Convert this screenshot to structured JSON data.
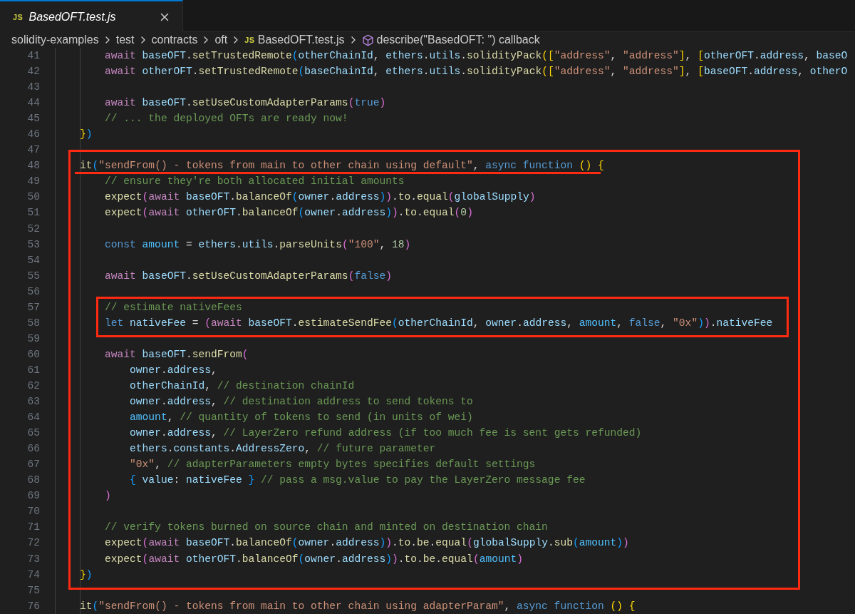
{
  "tab": {
    "icon_text": "JS",
    "title": "BasedOFT.test.js",
    "selected": true
  },
  "breadcrumb": {
    "folders": [
      "solidity-examples",
      "test",
      "contracts",
      "oft"
    ],
    "file_icon_text": "JS",
    "file": "BasedOFT.test.js",
    "symbol": "describe(\"BasedOFT: \") callback"
  },
  "lines": [
    {
      "n": "41",
      "tokens": [
        {
          "kind": "k",
          "text": "        await "
        },
        {
          "kind": "v",
          "text": "baseOFT"
        },
        {
          "kind": "p",
          "text": "."
        },
        {
          "kind": "f",
          "text": "setTrustedRemote"
        },
        {
          "kind": "b3",
          "text": "("
        },
        {
          "kind": "v",
          "text": "otherChainId"
        },
        {
          "kind": "p",
          "text": ", "
        },
        {
          "kind": "v",
          "text": "ethers"
        },
        {
          "kind": "p",
          "text": "."
        },
        {
          "kind": "v",
          "text": "utils"
        },
        {
          "kind": "p",
          "text": "."
        },
        {
          "kind": "f",
          "text": "solidityPack"
        },
        {
          "kind": "b1",
          "text": "(["
        },
        {
          "kind": "t",
          "text": "\"address\""
        },
        {
          "kind": "p",
          "text": ", "
        },
        {
          "kind": "t",
          "text": "\"address\""
        },
        {
          "kind": "b1",
          "text": "]"
        },
        {
          "kind": "p",
          "text": ", "
        },
        {
          "kind": "b1",
          "text": "["
        },
        {
          "kind": "v",
          "text": "otherOFT"
        },
        {
          "kind": "p",
          "text": "."
        },
        {
          "kind": "v",
          "text": "address"
        },
        {
          "kind": "p",
          "text": ", "
        },
        {
          "kind": "v",
          "text": "baseO"
        }
      ]
    },
    {
      "n": "42",
      "tokens": [
        {
          "kind": "k",
          "text": "        await "
        },
        {
          "kind": "v",
          "text": "otherOFT"
        },
        {
          "kind": "p",
          "text": "."
        },
        {
          "kind": "f",
          "text": "setTrustedRemote"
        },
        {
          "kind": "b3",
          "text": "("
        },
        {
          "kind": "v",
          "text": "baseChainId"
        },
        {
          "kind": "p",
          "text": ", "
        },
        {
          "kind": "v",
          "text": "ethers"
        },
        {
          "kind": "p",
          "text": "."
        },
        {
          "kind": "v",
          "text": "utils"
        },
        {
          "kind": "p",
          "text": "."
        },
        {
          "kind": "f",
          "text": "solidityPack"
        },
        {
          "kind": "b1",
          "text": "(["
        },
        {
          "kind": "t",
          "text": "\"address\""
        },
        {
          "kind": "p",
          "text": ", "
        },
        {
          "kind": "t",
          "text": "\"address\""
        },
        {
          "kind": "b1",
          "text": "]"
        },
        {
          "kind": "p",
          "text": ", "
        },
        {
          "kind": "b1",
          "text": "["
        },
        {
          "kind": "v",
          "text": "baseOFT"
        },
        {
          "kind": "p",
          "text": "."
        },
        {
          "kind": "v",
          "text": "address"
        },
        {
          "kind": "p",
          "text": ", "
        },
        {
          "kind": "v",
          "text": "otherO"
        }
      ]
    },
    {
      "n": "43"
    },
    {
      "n": "44",
      "tokens": [
        {
          "kind": "k",
          "text": "        await "
        },
        {
          "kind": "v",
          "text": "baseOFT"
        },
        {
          "kind": "p",
          "text": "."
        },
        {
          "kind": "f",
          "text": "setUseCustomAdapterParams"
        },
        {
          "kind": "b2",
          "text": "("
        },
        {
          "kind": "s",
          "text": "true"
        },
        {
          "kind": "b2",
          "text": ")"
        }
      ]
    },
    {
      "n": "45",
      "tokens": [
        {
          "kind": "m",
          "text": "        // ... the deployed OFTs are ready now!"
        }
      ]
    },
    {
      "n": "46",
      "tokens": [
        {
          "kind": "b1",
          "text": "    }"
        },
        {
          "kind": "b3",
          "text": ")"
        }
      ]
    },
    {
      "n": "47"
    },
    {
      "n": "48",
      "tokens": [
        {
          "kind": "f",
          "text": "    it"
        },
        {
          "kind": "b3",
          "text": "("
        },
        {
          "kind": "t",
          "text": "\"sendFrom() - tokens from main to other chain using default\""
        },
        {
          "kind": "p",
          "text": ", "
        },
        {
          "kind": "s",
          "text": "async function "
        },
        {
          "kind": "b1",
          "text": "() {"
        }
      ]
    },
    {
      "n": "49",
      "tokens": [
        {
          "kind": "m",
          "text": "        // ensure they're both allocated initial amounts"
        }
      ]
    },
    {
      "n": "50",
      "tokens": [
        {
          "kind": "f",
          "text": "        expect"
        },
        {
          "kind": "b2",
          "text": "("
        },
        {
          "kind": "k",
          "text": "await "
        },
        {
          "kind": "v",
          "text": "baseOFT"
        },
        {
          "kind": "p",
          "text": "."
        },
        {
          "kind": "f",
          "text": "balanceOf"
        },
        {
          "kind": "b3",
          "text": "("
        },
        {
          "kind": "v",
          "text": "owner"
        },
        {
          "kind": "p",
          "text": "."
        },
        {
          "kind": "v",
          "text": "address"
        },
        {
          "kind": "b3",
          "text": ")"
        },
        {
          "kind": "b2",
          "text": ")"
        },
        {
          "kind": "p",
          "text": "."
        },
        {
          "kind": "f",
          "text": "to"
        },
        {
          "kind": "p",
          "text": "."
        },
        {
          "kind": "f",
          "text": "equal"
        },
        {
          "kind": "b2",
          "text": "("
        },
        {
          "kind": "v",
          "text": "globalSupply"
        },
        {
          "kind": "b2",
          "text": ")"
        }
      ]
    },
    {
      "n": "51",
      "tokens": [
        {
          "kind": "f",
          "text": "        expect"
        },
        {
          "kind": "b2",
          "text": "("
        },
        {
          "kind": "k",
          "text": "await "
        },
        {
          "kind": "v",
          "text": "otherOFT"
        },
        {
          "kind": "p",
          "text": "."
        },
        {
          "kind": "f",
          "text": "balanceOf"
        },
        {
          "kind": "b3",
          "text": "("
        },
        {
          "kind": "v",
          "text": "owner"
        },
        {
          "kind": "p",
          "text": "."
        },
        {
          "kind": "v",
          "text": "address"
        },
        {
          "kind": "b3",
          "text": ")"
        },
        {
          "kind": "b2",
          "text": ")"
        },
        {
          "kind": "p",
          "text": "."
        },
        {
          "kind": "f",
          "text": "to"
        },
        {
          "kind": "p",
          "text": "."
        },
        {
          "kind": "f",
          "text": "equal"
        },
        {
          "kind": "b2",
          "text": "("
        },
        {
          "kind": "n",
          "text": "0"
        },
        {
          "kind": "b2",
          "text": ")"
        }
      ]
    },
    {
      "n": "52"
    },
    {
      "n": "53",
      "tokens": [
        {
          "kind": "s",
          "text": "        const "
        },
        {
          "kind": "c",
          "text": "amount"
        },
        {
          "kind": "p",
          "text": " = "
        },
        {
          "kind": "v",
          "text": "ethers"
        },
        {
          "kind": "p",
          "text": "."
        },
        {
          "kind": "v",
          "text": "utils"
        },
        {
          "kind": "p",
          "text": "."
        },
        {
          "kind": "f",
          "text": "parseUnits"
        },
        {
          "kind": "b2",
          "text": "("
        },
        {
          "kind": "t",
          "text": "\"100\""
        },
        {
          "kind": "p",
          "text": ", "
        },
        {
          "kind": "n",
          "text": "18"
        },
        {
          "kind": "b2",
          "text": ")"
        }
      ]
    },
    {
      "n": "54"
    },
    {
      "n": "55",
      "tokens": [
        {
          "kind": "k",
          "text": "        await "
        },
        {
          "kind": "v",
          "text": "baseOFT"
        },
        {
          "kind": "p",
          "text": "."
        },
        {
          "kind": "f",
          "text": "setUseCustomAdapterParams"
        },
        {
          "kind": "b2",
          "text": "("
        },
        {
          "kind": "s",
          "text": "false"
        },
        {
          "kind": "b2",
          "text": ")"
        }
      ]
    },
    {
      "n": "56"
    },
    {
      "n": "57",
      "tokens": [
        {
          "kind": "m",
          "text": "        // estimate nativeFees"
        }
      ]
    },
    {
      "n": "58",
      "tokens": [
        {
          "kind": "s",
          "text": "        let "
        },
        {
          "kind": "v",
          "text": "nativeFee"
        },
        {
          "kind": "p",
          "text": " = "
        },
        {
          "kind": "b2",
          "text": "("
        },
        {
          "kind": "k",
          "text": "await "
        },
        {
          "kind": "v",
          "text": "baseOFT"
        },
        {
          "kind": "p",
          "text": "."
        },
        {
          "kind": "f",
          "text": "estimateSendFee"
        },
        {
          "kind": "b3",
          "text": "("
        },
        {
          "kind": "v",
          "text": "otherChainId"
        },
        {
          "kind": "p",
          "text": ", "
        },
        {
          "kind": "v",
          "text": "owner"
        },
        {
          "kind": "p",
          "text": "."
        },
        {
          "kind": "v",
          "text": "address"
        },
        {
          "kind": "p",
          "text": ", "
        },
        {
          "kind": "c",
          "text": "amount"
        },
        {
          "kind": "p",
          "text": ", "
        },
        {
          "kind": "s",
          "text": "false"
        },
        {
          "kind": "p",
          "text": ", "
        },
        {
          "kind": "t",
          "text": "\"0x\""
        },
        {
          "kind": "b3",
          "text": ")"
        },
        {
          "kind": "b2",
          "text": ")"
        },
        {
          "kind": "p",
          "text": "."
        },
        {
          "kind": "v",
          "text": "nativeFee"
        }
      ]
    },
    {
      "n": "59"
    },
    {
      "n": "60",
      "tokens": [
        {
          "kind": "k",
          "text": "        await "
        },
        {
          "kind": "v",
          "text": "baseOFT"
        },
        {
          "kind": "p",
          "text": "."
        },
        {
          "kind": "f",
          "text": "sendFrom"
        },
        {
          "kind": "b2",
          "text": "("
        }
      ]
    },
    {
      "n": "61",
      "tokens": [
        {
          "kind": "v",
          "text": "            owner"
        },
        {
          "kind": "p",
          "text": "."
        },
        {
          "kind": "v",
          "text": "address"
        },
        {
          "kind": "p",
          "text": ","
        }
      ]
    },
    {
      "n": "62",
      "tokens": [
        {
          "kind": "v",
          "text": "            otherChainId"
        },
        {
          "kind": "p",
          "text": ", "
        },
        {
          "kind": "m",
          "text": "// destination chainId"
        }
      ]
    },
    {
      "n": "63",
      "tokens": [
        {
          "kind": "v",
          "text": "            owner"
        },
        {
          "kind": "p",
          "text": "."
        },
        {
          "kind": "v",
          "text": "address"
        },
        {
          "kind": "p",
          "text": ", "
        },
        {
          "kind": "m",
          "text": "// destination address to send tokens to"
        }
      ]
    },
    {
      "n": "64",
      "tokens": [
        {
          "kind": "c",
          "text": "            amount"
        },
        {
          "kind": "p",
          "text": ", "
        },
        {
          "kind": "m",
          "text": "// quantity of tokens to send (in units of wei)"
        }
      ]
    },
    {
      "n": "65",
      "tokens": [
        {
          "kind": "v",
          "text": "            owner"
        },
        {
          "kind": "p",
          "text": "."
        },
        {
          "kind": "v",
          "text": "address"
        },
        {
          "kind": "p",
          "text": ", "
        },
        {
          "kind": "m",
          "text": "// LayerZero refund address (if too much fee is sent gets refunded)"
        }
      ]
    },
    {
      "n": "66",
      "tokens": [
        {
          "kind": "v",
          "text": "            ethers"
        },
        {
          "kind": "p",
          "text": "."
        },
        {
          "kind": "v",
          "text": "constants"
        },
        {
          "kind": "p",
          "text": "."
        },
        {
          "kind": "v",
          "text": "AddressZero"
        },
        {
          "kind": "p",
          "text": ", "
        },
        {
          "kind": "m",
          "text": "// future parameter"
        }
      ]
    },
    {
      "n": "67",
      "tokens": [
        {
          "kind": "t",
          "text": "            \"0x\""
        },
        {
          "kind": "p",
          "text": ", "
        },
        {
          "kind": "m",
          "text": "// adapterParameters empty bytes specifies default settings"
        }
      ]
    },
    {
      "n": "68",
      "tokens": [
        {
          "kind": "b3",
          "text": "            { "
        },
        {
          "kind": "v",
          "text": "value"
        },
        {
          "kind": "p",
          "text": ": "
        },
        {
          "kind": "v",
          "text": "nativeFee "
        },
        {
          "kind": "b3",
          "text": "} "
        },
        {
          "kind": "m",
          "text": "// pass a msg.value to pay the LayerZero message fee"
        }
      ]
    },
    {
      "n": "69",
      "tokens": [
        {
          "kind": "b2",
          "text": "        )"
        }
      ]
    },
    {
      "n": "70"
    },
    {
      "n": "71",
      "tokens": [
        {
          "kind": "m",
          "text": "        // verify tokens burned on source chain and minted on destination chain"
        }
      ]
    },
    {
      "n": "72",
      "tokens": [
        {
          "kind": "f",
          "text": "        expect"
        },
        {
          "kind": "b2",
          "text": "("
        },
        {
          "kind": "k",
          "text": "await "
        },
        {
          "kind": "v",
          "text": "baseOFT"
        },
        {
          "kind": "p",
          "text": "."
        },
        {
          "kind": "f",
          "text": "balanceOf"
        },
        {
          "kind": "b3",
          "text": "("
        },
        {
          "kind": "v",
          "text": "owner"
        },
        {
          "kind": "p",
          "text": "."
        },
        {
          "kind": "v",
          "text": "address"
        },
        {
          "kind": "b3",
          "text": ")"
        },
        {
          "kind": "b2",
          "text": ")"
        },
        {
          "kind": "p",
          "text": "."
        },
        {
          "kind": "f",
          "text": "to"
        },
        {
          "kind": "p",
          "text": "."
        },
        {
          "kind": "f",
          "text": "be"
        },
        {
          "kind": "p",
          "text": "."
        },
        {
          "kind": "f",
          "text": "equal"
        },
        {
          "kind": "b2",
          "text": "("
        },
        {
          "kind": "v",
          "text": "globalSupply"
        },
        {
          "kind": "p",
          "text": "."
        },
        {
          "kind": "f",
          "text": "sub"
        },
        {
          "kind": "b3",
          "text": "("
        },
        {
          "kind": "c",
          "text": "amount"
        },
        {
          "kind": "b3",
          "text": ")"
        },
        {
          "kind": "b2",
          "text": ")"
        }
      ]
    },
    {
      "n": "73",
      "tokens": [
        {
          "kind": "f",
          "text": "        expect"
        },
        {
          "kind": "b2",
          "text": "("
        },
        {
          "kind": "k",
          "text": "await "
        },
        {
          "kind": "v",
          "text": "otherOFT"
        },
        {
          "kind": "p",
          "text": "."
        },
        {
          "kind": "f",
          "text": "balanceOf"
        },
        {
          "kind": "b3",
          "text": "("
        },
        {
          "kind": "v",
          "text": "owner"
        },
        {
          "kind": "p",
          "text": "."
        },
        {
          "kind": "v",
          "text": "address"
        },
        {
          "kind": "b3",
          "text": ")"
        },
        {
          "kind": "b2",
          "text": ")"
        },
        {
          "kind": "p",
          "text": "."
        },
        {
          "kind": "f",
          "text": "to"
        },
        {
          "kind": "p",
          "text": "."
        },
        {
          "kind": "f",
          "text": "be"
        },
        {
          "kind": "p",
          "text": "."
        },
        {
          "kind": "f",
          "text": "equal"
        },
        {
          "kind": "b2",
          "text": "("
        },
        {
          "kind": "c",
          "text": "amount"
        },
        {
          "kind": "b2",
          "text": ")"
        }
      ]
    },
    {
      "n": "74",
      "tokens": [
        {
          "kind": "b1",
          "text": "    }"
        },
        {
          "kind": "b3",
          "text": ")"
        }
      ]
    },
    {
      "n": "75"
    },
    {
      "n": "76",
      "tokens": [
        {
          "kind": "f",
          "text": "    it"
        },
        {
          "kind": "b3",
          "text": "("
        },
        {
          "kind": "t",
          "text": "\"sendFrom() - tokens from main to other chain using adapterParam\""
        },
        {
          "kind": "p",
          "text": ", "
        },
        {
          "kind": "s",
          "text": "async function "
        },
        {
          "kind": "b1",
          "text": "() {"
        }
      ]
    }
  ]
}
